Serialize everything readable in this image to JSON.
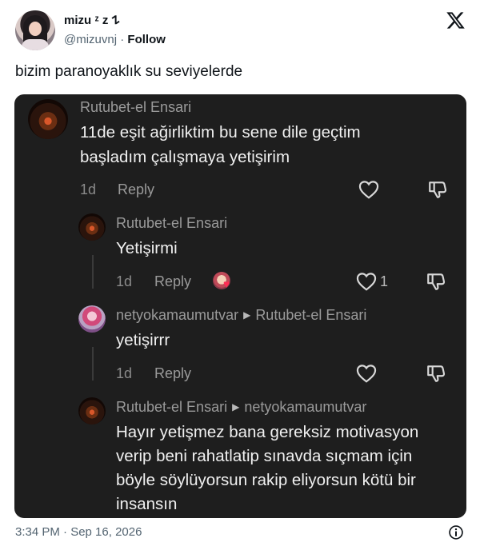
{
  "author": {
    "display_name": "mizu ᶻ z 𐰁",
    "handle": "@mizuvnj",
    "separator": "·",
    "follow_label": "Follow"
  },
  "tweet": {
    "text": "bizim paranoyaklık su seviyelerde",
    "timestamp": "3:34 PM · Sep 16, 2026"
  },
  "screenshot": {
    "comments": [
      {
        "author": "Rutubet-el Ensari",
        "lines": [
          "11de eşit ağirliktim bu sene dile geçtim",
          "başladım çalışmaya yetişirim"
        ],
        "age": "1d",
        "reply_label": "Reply"
      },
      {
        "author": "Rutubet-el Ensari",
        "lines": [
          "Yetişirmi"
        ],
        "age": "1d",
        "reply_label": "Reply",
        "like_count": "1"
      },
      {
        "author": "netyokamaumutvar",
        "reply_to": "Rutubet-el Ensari",
        "lines": [
          "yetişirrr"
        ],
        "age": "1d",
        "reply_label": "Reply"
      },
      {
        "author": "Rutubet-el Ensari",
        "reply_to": "netyokamaumutvar",
        "lines": [
          "Hayır yetişmez bana gereksiz motivasyon",
          "verip beni rahatlatip sınavda sıçmam için",
          "böyle söylüyorsun rakip eliyorsun kötü bir",
          "insansın"
        ]
      }
    ]
  },
  "icons": {
    "brand": "x-logo-icon",
    "like": "heart-outline-icon",
    "dislike": "thumbs-down-icon",
    "info": "info-icon"
  }
}
